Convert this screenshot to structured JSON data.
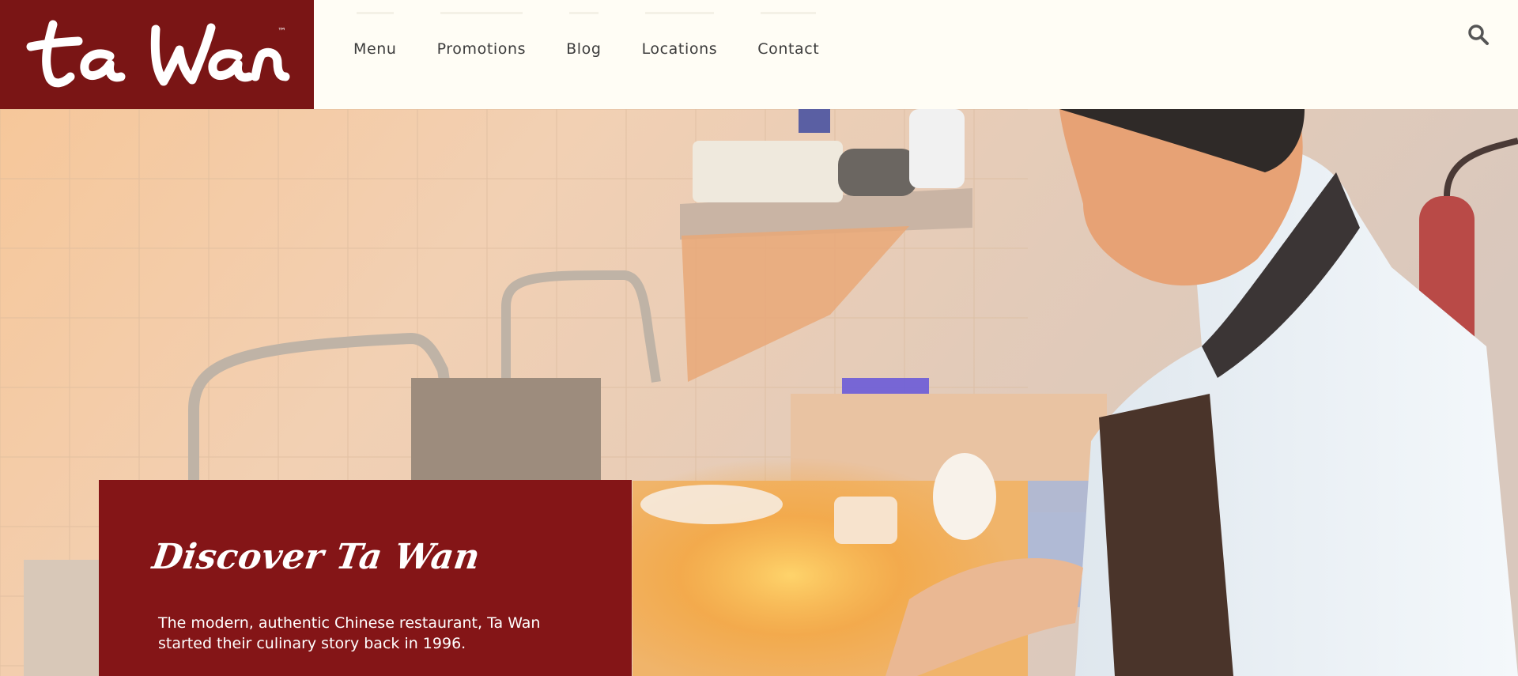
{
  "brand": {
    "name": "ta Wan",
    "trademark": "™",
    "color": "#7a1515"
  },
  "nav": {
    "items": [
      {
        "label": "Menu"
      },
      {
        "label": "Promotions"
      },
      {
        "label": "Blog"
      },
      {
        "label": "Locations"
      },
      {
        "label": "Contact"
      }
    ],
    "search_icon": "search-icon"
  },
  "hero": {
    "image": "chef-cooking-in-kitchen",
    "card": {
      "title": "Discover Ta Wan",
      "text": "The modern, authentic Chinese restaurant, Ta Wan started their culinary story back in 1996.",
      "color": "#841517"
    }
  }
}
